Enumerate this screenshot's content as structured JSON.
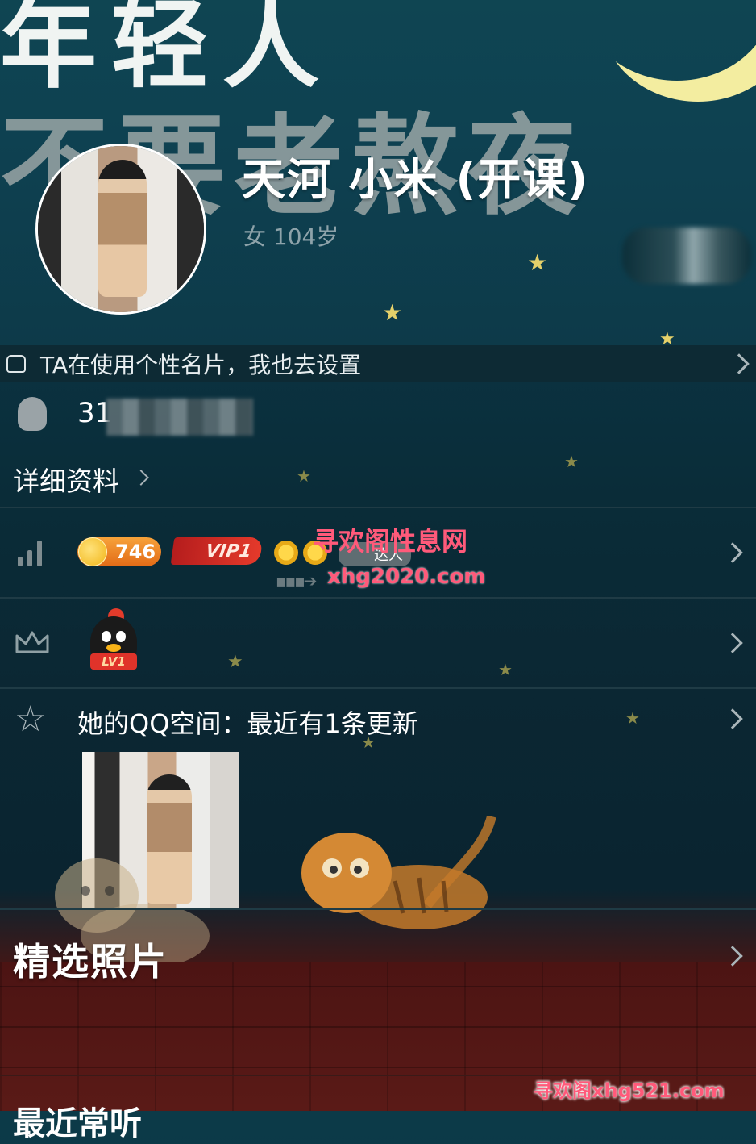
{
  "header": {
    "banner_line1": "年轻人",
    "banner_line2": "不要老熬夜",
    "nickname": "天河  小米 (开课)",
    "gender_age": "女 104岁"
  },
  "tip_bar": {
    "text": "TA在使用个性名片，我也去设置"
  },
  "account": {
    "qq_number_visible": "31",
    "detail_label": "详细资料"
  },
  "level_row": {
    "coin_value": "746",
    "vip_label": "VIP1",
    "daren_label": "达人"
  },
  "watermarks": {
    "site_name": "寻欢阁性息网",
    "site_url": "xhg2020.com",
    "bottom_mark": "寻欢阁xhg521.com"
  },
  "badge_row": {
    "mascot_label": "LV1"
  },
  "qzone": {
    "text": "她的QQ空间：最近有1条更新"
  },
  "sections": {
    "featured_photos": "精选照片",
    "recent_label": "最近常听"
  },
  "colors": {
    "background": "#0b2733",
    "accent_star": "#e5d16a",
    "watermark": "#ff5a7a",
    "coin_badge": "#e26b17",
    "vip_badge": "#e53a2b"
  },
  "icons": {
    "qq": "penguin-icon",
    "level": "level-bars-icon",
    "crown": "crown-icon",
    "qzone": "star-outline-icon",
    "tip": "card-icon"
  }
}
